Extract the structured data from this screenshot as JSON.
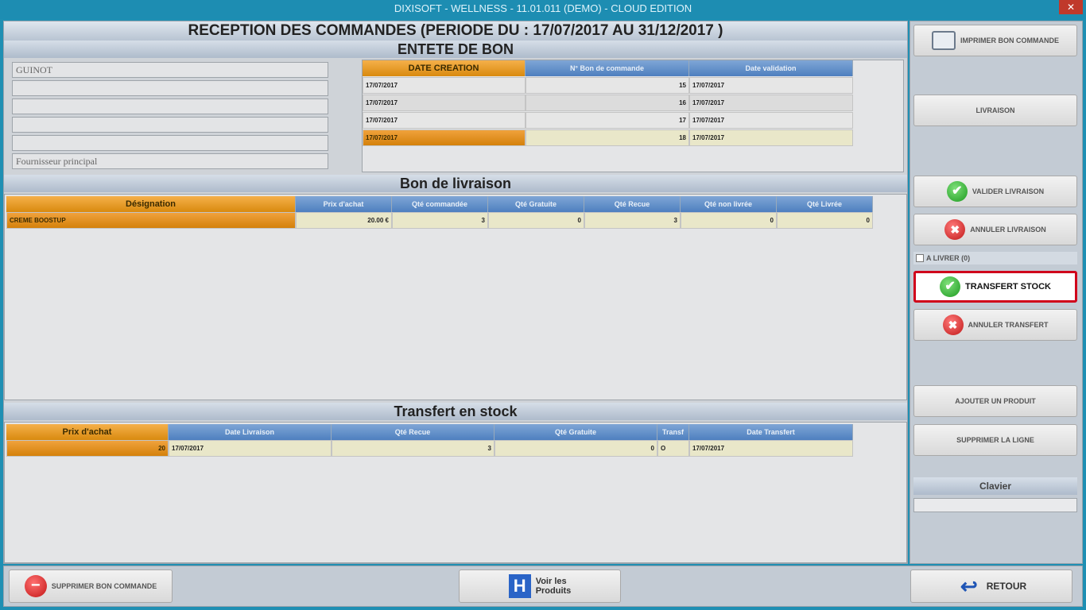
{
  "window": {
    "title": "DIXISOFT - WELLNESS - 11.01.011 (DEMO) - CLOUD EDITION",
    "close": "✕"
  },
  "page_title": "RECEPTION DES COMMANDES (PERIODE DU : 17/07/2017  AU  31/12/2017 )",
  "entete": {
    "title": "ENTETE DE BON",
    "fields": [
      "GUINOT",
      "",
      "",
      "",
      "",
      "Fournisseur principal"
    ],
    "columns": [
      "DATE CREATION",
      "N° Bon de commande",
      "Date validation"
    ],
    "rows": [
      [
        "17/07/2017",
        "15",
        "17/07/2017"
      ],
      [
        "17/07/2017",
        "16",
        "17/07/2017"
      ],
      [
        "17/07/2017",
        "17",
        "17/07/2017"
      ],
      [
        "17/07/2017",
        "18",
        "17/07/2017"
      ]
    ]
  },
  "livraison": {
    "title": "Bon de livraison",
    "columns": [
      "Désignation",
      "Prix d'achat",
      "Qté commandée",
      "Qté Gratuite",
      "Qté Recue",
      "Qté non livrée",
      "Qté Livrée"
    ],
    "rows": [
      [
        "CREME BOOSTUP",
        "20.00 €",
        "3",
        "0",
        "3",
        "0",
        "0"
      ]
    ]
  },
  "transfert": {
    "title": "Transfert en stock",
    "columns": [
      "Prix d'achat",
      "Date Livraison",
      "Qté Recue",
      "Qté Gratuite",
      "Transf",
      "Date Transfert"
    ],
    "rows": [
      [
        "20",
        "17/07/2017",
        "3",
        "0",
        "O",
        "17/07/2017"
      ]
    ]
  },
  "sidebar": {
    "imprimer": "IMPRIMER BON COMMANDE",
    "livraison": "LIVRAISON",
    "valider_livraison": "VALIDER LIVRAISON",
    "annuler_livraison": "ANNULER LIVRAISON",
    "a_livrer": "A LIVRER (0)",
    "transfert_stock": "TRANSFERT STOCK",
    "annuler_transfert": "ANNULER TRANSFERT",
    "ajouter_produit": "AJOUTER UN PRODUIT",
    "supprimer_ligne": "SUPPRIMER LA LIGNE",
    "clavier": "Clavier"
  },
  "bottom": {
    "supprimer_bon": "SUPPRIMER BON COMMANDE",
    "voir_produits_1": "Voir les",
    "voir_produits_2": "Produits",
    "retour": "RETOUR"
  },
  "icons": {
    "ok": "✔",
    "cancel": "✖",
    "minus": "−",
    "h": "H",
    "back": "↩"
  },
  "colors": {
    "accent_orange": "#e1931f",
    "header_blue": "#4e7fbf",
    "highlight_red": "#d0021b",
    "chrome_teal": "#1f8fb3"
  }
}
